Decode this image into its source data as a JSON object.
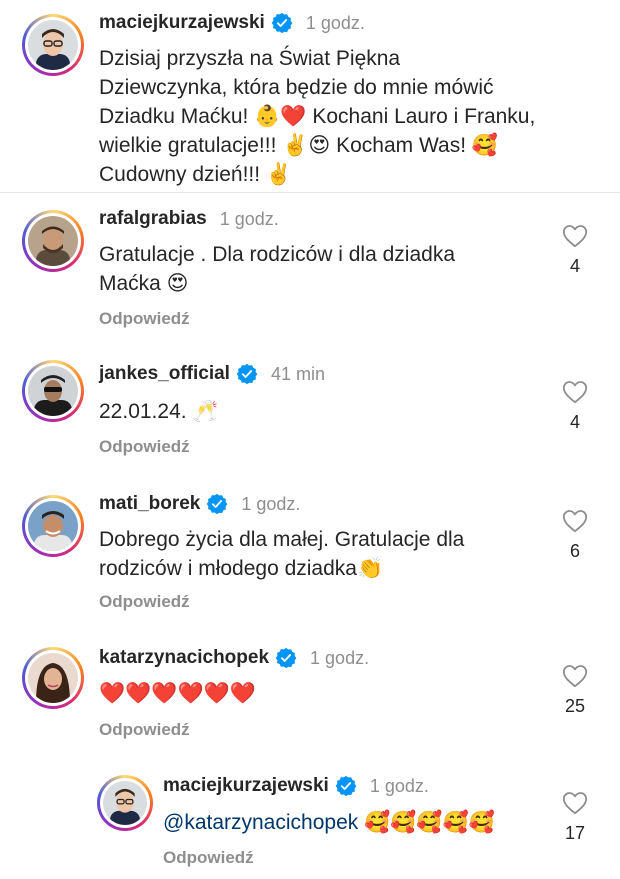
{
  "caption": {
    "username": "maciejkurzajewski",
    "time": "1 godz.",
    "line1": "Dzisiaj przyszła na Świat  Piękna",
    "line2": "Dziewczynka, która będzie do mnie mówić",
    "line3": "Dziadku Maćku! 👶❤️ Kochani Lauro i Franku,",
    "line4": "wielkie gratulacje!!! ✌️😍 Kocham Was! 🥰",
    "line5": "Cudowny dzień!!! ✌️"
  },
  "comments": [
    {
      "username": "rafalgrabias",
      "time": "1 godz.",
      "line1": "Gratulacje . Dla rodziców i dla dziadka",
      "line2": "Maćka 😍",
      "reply": "Odpowiedź",
      "likes": "4"
    },
    {
      "username": "jankes_official",
      "time": "41 min",
      "line1": "22.01.24. 🥂",
      "reply": "Odpowiedź",
      "likes": "4"
    },
    {
      "username": "mati_borek",
      "time": "1 godz.",
      "line1": "Dobrego życia dla małej. Gratulacje dla",
      "line2": "rodziców i młodego dziadka👏",
      "reply": "Odpowiedź",
      "likes": "6"
    },
    {
      "username": "katarzynacichopek",
      "time": "1 godz.",
      "line1": "❤️❤️❤️❤️❤️❤️",
      "reply": "Odpowiedź",
      "likes": "25"
    }
  ],
  "reply_comment": {
    "username": "maciejkurzajewski",
    "time": "1 godz.",
    "mention": "@katarzynacichopek",
    "emojis": " 🥰🥰🥰🥰🥰",
    "reply": "Odpowiedź",
    "likes": "17"
  },
  "icons": {
    "verified": "verified-badge-icon",
    "like": "heart-outline-icon"
  },
  "colors": {
    "verified": "#0095f6",
    "secondary_text": "#8e8e8e",
    "mention": "#00376b"
  }
}
